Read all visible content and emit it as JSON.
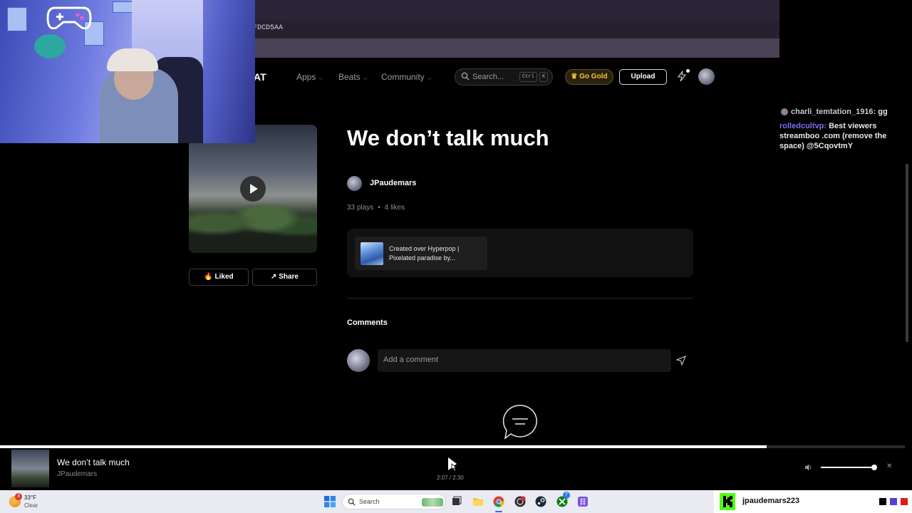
{
  "browser": {
    "address_fragment": "FDCD5AA"
  },
  "nav": {
    "logo_fragment": "AT",
    "items": [
      {
        "label": "Apps"
      },
      {
        "label": "Beats"
      },
      {
        "label": "Community"
      }
    ],
    "search_placeholder": "Search...",
    "shortcut_keys": [
      "Ctrl",
      "K"
    ],
    "go_gold_label": "Go Gold",
    "upload_label": "Upload"
  },
  "track": {
    "title": "We don’t talk much",
    "artist": "JPaudemars",
    "plays": "33 plays",
    "likes": "4 likes",
    "liked_label": "Liked",
    "share_label": "Share",
    "sample_line1": "Created over Hyperpop |",
    "sample_line2": "Pixelated paradise by..."
  },
  "comments": {
    "heading": "Comments",
    "placeholder": "Add a comment"
  },
  "chat": {
    "messages": [
      {
        "user": "charli_temtation_1916:",
        "text": "gg"
      },
      {
        "user": "rolledcultvp:",
        "text": "Best viewers"
      },
      {
        "user": "",
        "text": "streamboo .com (remove the"
      },
      {
        "user": "",
        "text": "space) @5CqovtmY"
      }
    ]
  },
  "player": {
    "title": "We don’t talk much",
    "artist": "JPaudemars",
    "time": "2:07 / 2:30",
    "progress": 0.847,
    "volume": 0.99
  },
  "taskbar": {
    "temperature": "33°F",
    "condition": "Clear",
    "weather_badge": "3",
    "search_placeholder": "Search",
    "xbox_badge": "7",
    "icons": [
      "windows-start-icon",
      "search-icon",
      "task-view-icon",
      "file-explorer-icon",
      "chrome-icon",
      "obs-icon",
      "steam-icon",
      "xbox-icon",
      "calendar-grid-icon"
    ]
  },
  "kick": {
    "username": "jpaudemars223",
    "colors": [
      "#000000",
      "#5b3bd6",
      "#e01b1b"
    ]
  },
  "colors": {
    "accent_gold": "#f0c43a",
    "kick_green": "#53fc18"
  }
}
